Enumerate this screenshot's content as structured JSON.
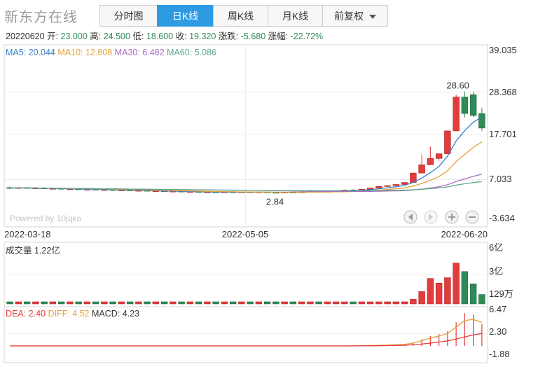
{
  "brand": "新东方在线",
  "tabs": [
    {
      "label": "分时图",
      "active": false
    },
    {
      "label": "日K线",
      "active": true
    },
    {
      "label": "周K线",
      "active": false
    },
    {
      "label": "月K线",
      "active": false
    },
    {
      "label": "前复权",
      "active": false,
      "dropdown": true
    }
  ],
  "info_line": [
    {
      "label": "20220620",
      "value": "",
      "color": "#333333"
    },
    {
      "label": "开:",
      "value": "23.000",
      "color": "#2e8b57"
    },
    {
      "label": "高:",
      "value": "24.500",
      "color": "#2e8b57"
    },
    {
      "label": "低:",
      "value": "18.600",
      "color": "#2e8b57"
    },
    {
      "label": "收:",
      "value": "19.320",
      "color": "#2e8b57"
    },
    {
      "label": "涨跌:",
      "value": "-5.680",
      "color": "#2e8b57"
    },
    {
      "label": "涨幅:",
      "value": "-22.72%",
      "color": "#2e8b57"
    }
  ],
  "ma_legend": [
    {
      "label": "MA5: 20.044",
      "color": "#3a7fc4"
    },
    {
      "label": "MA10: 12.808",
      "color": "#e3a13c"
    },
    {
      "label": "MA30: 6.482",
      "color": "#a86fc4"
    },
    {
      "label": "MA60: 5.086",
      "color": "#5fa88a"
    }
  ],
  "watermark": "Powered by 10jqka",
  "volume_legend": "成交量 1.22亿",
  "macd_legend": [
    {
      "label": "DEA: 2.40",
      "color": "#e23c3c"
    },
    {
      "label": "DIFF: 4.52",
      "color": "#e3a13c"
    },
    {
      "label": "MACD: 4.23",
      "color": "#333333"
    }
  ],
  "colors": {
    "up": "#e23c3c",
    "down": "#2e8b57",
    "grid": "#e6e6e6",
    "axis": "#555555"
  },
  "icons": [
    "left-arrow-icon",
    "right-arrow-icon",
    "zoom-in-icon",
    "zoom-out-icon"
  ],
  "chart_data": [
    {
      "type": "candlestick",
      "title": "日K线",
      "x_tick_labels": [
        "2022-03-18",
        "2022-05-05",
        "2022-06-20"
      ],
      "y_tick_labels": [
        "39.035",
        "28.368",
        "17.701",
        "7.033",
        "-3.634"
      ],
      "ylim": [
        -3.634,
        39.035
      ],
      "annotations": [
        {
          "text": "28.60",
          "note": "highest"
        },
        {
          "text": "2.84",
          "note": "lowest"
        }
      ],
      "candles": [
        {
          "o": 4.2,
          "h": 4.5,
          "l": 3.9,
          "c": 4.1
        },
        {
          "o": 4.1,
          "h": 4.4,
          "l": 3.9,
          "c": 4.2
        },
        {
          "o": 4.2,
          "h": 4.4,
          "l": 3.9,
          "c": 4.0
        },
        {
          "o": 4.0,
          "h": 4.3,
          "l": 3.8,
          "c": 4.1
        },
        {
          "o": 4.1,
          "h": 4.3,
          "l": 3.8,
          "c": 3.9
        },
        {
          "o": 3.9,
          "h": 4.2,
          "l": 3.7,
          "c": 4.0
        },
        {
          "o": 4.0,
          "h": 4.2,
          "l": 3.7,
          "c": 3.8
        },
        {
          "o": 3.8,
          "h": 4.1,
          "l": 3.6,
          "c": 3.9
        },
        {
          "o": 3.9,
          "h": 4.1,
          "l": 3.6,
          "c": 3.7
        },
        {
          "o": 3.7,
          "h": 4.0,
          "l": 3.5,
          "c": 3.8
        },
        {
          "o": 3.8,
          "h": 4.0,
          "l": 3.5,
          "c": 3.6
        },
        {
          "o": 3.6,
          "h": 3.9,
          "l": 3.4,
          "c": 3.7
        },
        {
          "o": 3.7,
          "h": 3.9,
          "l": 3.4,
          "c": 3.5
        },
        {
          "o": 3.5,
          "h": 3.8,
          "l": 3.3,
          "c": 3.6
        },
        {
          "o": 3.6,
          "h": 3.8,
          "l": 3.3,
          "c": 3.4
        },
        {
          "o": 3.4,
          "h": 3.7,
          "l": 3.2,
          "c": 3.5
        },
        {
          "o": 3.5,
          "h": 3.7,
          "l": 3.2,
          "c": 3.3
        },
        {
          "o": 3.3,
          "h": 3.6,
          "l": 3.1,
          "c": 3.4
        },
        {
          "o": 3.4,
          "h": 3.6,
          "l": 3.1,
          "c": 3.2
        },
        {
          "o": 3.2,
          "h": 3.5,
          "l": 3.0,
          "c": 3.3
        },
        {
          "o": 3.3,
          "h": 3.5,
          "l": 3.0,
          "c": 3.1
        },
        {
          "o": 3.1,
          "h": 3.4,
          "l": 2.9,
          "c": 3.2
        },
        {
          "o": 3.2,
          "h": 3.4,
          "l": 2.9,
          "c": 3.0
        },
        {
          "o": 3.0,
          "h": 3.3,
          "l": 2.9,
          "c": 3.1
        },
        {
          "o": 3.1,
          "h": 3.3,
          "l": 2.9,
          "c": 3.0
        },
        {
          "o": 3.0,
          "h": 3.2,
          "l": 2.9,
          "c": 3.1
        },
        {
          "o": 3.1,
          "h": 3.3,
          "l": 2.9,
          "c": 3.0
        },
        {
          "o": 3.0,
          "h": 3.2,
          "l": 2.9,
          "c": 3.1
        },
        {
          "o": 3.1,
          "h": 3.2,
          "l": 2.9,
          "c": 3.0
        },
        {
          "o": 3.0,
          "h": 3.2,
          "l": 2.9,
          "c": 3.1
        },
        {
          "o": 3.1,
          "h": 3.2,
          "l": 2.9,
          "c": 3.0
        },
        {
          "o": 3.0,
          "h": 3.1,
          "l": 2.84,
          "c": 2.95
        },
        {
          "o": 2.95,
          "h": 3.1,
          "l": 2.9,
          "c": 3.05
        },
        {
          "o": 3.05,
          "h": 3.2,
          "l": 2.9,
          "c": 3.0
        },
        {
          "o": 3.0,
          "h": 3.2,
          "l": 2.9,
          "c": 3.1
        },
        {
          "o": 3.1,
          "h": 3.3,
          "l": 3.0,
          "c": 3.2
        },
        {
          "o": 3.2,
          "h": 3.4,
          "l": 3.0,
          "c": 3.1
        },
        {
          "o": 3.1,
          "h": 3.3,
          "l": 3.0,
          "c": 3.25
        },
        {
          "o": 3.25,
          "h": 3.5,
          "l": 3.1,
          "c": 3.4
        },
        {
          "o": 3.4,
          "h": 3.7,
          "l": 3.3,
          "c": 3.6
        },
        {
          "o": 3.6,
          "h": 3.8,
          "l": 3.4,
          "c": 3.5
        },
        {
          "o": 3.5,
          "h": 3.9,
          "l": 3.4,
          "c": 3.8
        },
        {
          "o": 3.8,
          "h": 4.2,
          "l": 3.7,
          "c": 4.1
        },
        {
          "o": 4.1,
          "h": 4.6,
          "l": 4.0,
          "c": 4.5
        },
        {
          "o": 4.5,
          "h": 4.9,
          "l": 4.3,
          "c": 4.7
        },
        {
          "o": 4.7,
          "h": 5.2,
          "l": 4.5,
          "c": 5.0
        },
        {
          "o": 5.0,
          "h": 5.6,
          "l": 4.9,
          "c": 5.5
        },
        {
          "o": 5.5,
          "h": 7.9,
          "l": 5.4,
          "c": 7.9
        },
        {
          "o": 7.9,
          "h": 12.6,
          "l": 7.8,
          "c": 10.0
        },
        {
          "o": 10.0,
          "h": 14.6,
          "l": 9.9,
          "c": 11.6
        },
        {
          "o": 11.6,
          "h": 12.8,
          "l": 11.0,
          "c": 12.8
        },
        {
          "o": 12.8,
          "h": 18.6,
          "l": 12.7,
          "c": 18.6
        },
        {
          "o": 18.6,
          "h": 27.8,
          "l": 18.5,
          "c": 27.2
        },
        {
          "o": 27.2,
          "h": 28.6,
          "l": 22.0,
          "c": 23.0
        },
        {
          "o": 27.8,
          "h": 28.6,
          "l": 22.1,
          "c": 22.5
        },
        {
          "o": 23.0,
          "h": 24.5,
          "l": 18.6,
          "c": 19.32
        }
      ],
      "ma_series": [
        {
          "name": "MA5",
          "last": 20.044
        },
        {
          "name": "MA10",
          "last": 12.808
        },
        {
          "name": "MA30",
          "last": 6.482
        },
        {
          "name": "MA60",
          "last": 5.086
        }
      ]
    },
    {
      "type": "bar",
      "title": "成交量 1.22亿",
      "y_tick_labels": [
        "6亿",
        "3亿",
        "129万"
      ],
      "ylim": [
        0,
        6.0
      ],
      "unit": "亿",
      "values": [
        0.06,
        0.05,
        0.06,
        0.05,
        0.05,
        0.06,
        0.05,
        0.05,
        0.06,
        0.05,
        0.05,
        0.06,
        0.05,
        0.05,
        0.06,
        0.05,
        0.05,
        0.06,
        0.05,
        0.05,
        0.06,
        0.05,
        0.05,
        0.06,
        0.05,
        0.05,
        0.06,
        0.05,
        0.05,
        0.06,
        0.05,
        0.05,
        0.06,
        0.05,
        0.05,
        0.06,
        0.05,
        0.05,
        0.06,
        0.05,
        0.06,
        0.07,
        0.08,
        0.08,
        0.09,
        0.1,
        0.12,
        0.6,
        1.6,
        3.3,
        2.7,
        3.4,
        5.3,
        4.2,
        2.6,
        1.22
      ]
    },
    {
      "type": "line",
      "title": "MACD",
      "y_tick_labels": [
        "6.47",
        "2.30",
        "-1.88"
      ],
      "ylim": [
        -1.88,
        6.47
      ],
      "series": [
        {
          "name": "DEA",
          "last": 2.4
        },
        {
          "name": "DIFF",
          "last": 4.52
        },
        {
          "name": "MACD",
          "last": 4.23
        }
      ],
      "dea": [
        0,
        0,
        0,
        0,
        0,
        0,
        0,
        0,
        0,
        0,
        0,
        0,
        0,
        0,
        0,
        0,
        0,
        0,
        0,
        0,
        0,
        0,
        0,
        0,
        0,
        0,
        0,
        0,
        0,
        0,
        0,
        0,
        0,
        0,
        0,
        0,
        0,
        0,
        0,
        0,
        0.01,
        0.02,
        0.03,
        0.05,
        0.07,
        0.1,
        0.14,
        0.22,
        0.36,
        0.55,
        0.75,
        0.98,
        1.32,
        1.75,
        2.1,
        2.4
      ],
      "diff": [
        0,
        0,
        0,
        0,
        0,
        0,
        0,
        0,
        0,
        0,
        0,
        0,
        0,
        0,
        0,
        0,
        0,
        0,
        0,
        0,
        0,
        0,
        0,
        0,
        0,
        0,
        0,
        0,
        0,
        0,
        0,
        0,
        0,
        0,
        0,
        0,
        0,
        0,
        0,
        0,
        0.03,
        0.05,
        0.08,
        0.12,
        0.16,
        0.22,
        0.3,
        0.55,
        1.0,
        1.5,
        1.9,
        2.4,
        3.6,
        4.9,
        5.1,
        4.52
      ],
      "macd": [
        0,
        0,
        0,
        0,
        0,
        0,
        0,
        0,
        0,
        0,
        0,
        0,
        0,
        0,
        0,
        0,
        0,
        0,
        0,
        0,
        0,
        0,
        0,
        0,
        0,
        0,
        0,
        0,
        0,
        0,
        0,
        0,
        0,
        0,
        0,
        0,
        0,
        0,
        0,
        0,
        0.04,
        0.06,
        0.1,
        0.14,
        0.18,
        0.24,
        0.32,
        0.66,
        1.28,
        1.9,
        2.3,
        2.84,
        4.56,
        6.3,
        6.0,
        4.23
      ]
    }
  ]
}
